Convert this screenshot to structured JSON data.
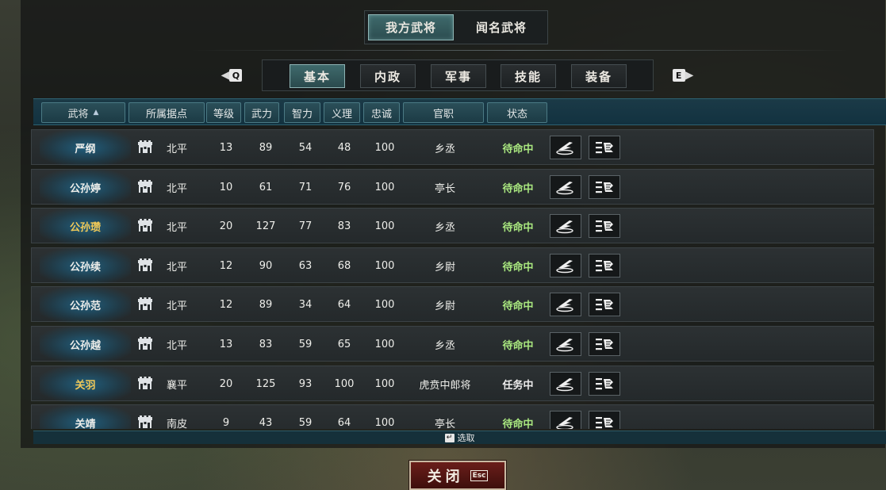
{
  "top_tabs": [
    {
      "label": "我方武将",
      "active": true
    },
    {
      "label": "闻名武将",
      "active": false
    }
  ],
  "nav": {
    "prev_key": "Q",
    "next_key": "E"
  },
  "sub_tabs": [
    {
      "label": "基本",
      "active": true
    },
    {
      "label": "内政",
      "active": false
    },
    {
      "label": "军事",
      "active": false
    },
    {
      "label": "技能",
      "active": false
    },
    {
      "label": "装备",
      "active": false
    }
  ],
  "columns": [
    "武将",
    "所属据点",
    "等级",
    "武力",
    "智力",
    "义理",
    "忠诚",
    "官职",
    "状态"
  ],
  "rows": [
    {
      "name": "严纲",
      "base": "北平",
      "level": "13",
      "str": "89",
      "int": "54",
      "honor": "48",
      "loyalty": "100",
      "title": "乡丞",
      "status": "待命中",
      "gold": false
    },
    {
      "name": "公孙婷",
      "base": "北平",
      "level": "10",
      "str": "61",
      "int": "71",
      "honor": "76",
      "loyalty": "100",
      "title": "亭长",
      "status": "待命中",
      "gold": false
    },
    {
      "name": "公孙瓒",
      "base": "北平",
      "level": "20",
      "str": "127",
      "int": "77",
      "honor": "83",
      "loyalty": "100",
      "title": "乡丞",
      "status": "待命中",
      "gold": true
    },
    {
      "name": "公孙续",
      "base": "北平",
      "level": "12",
      "str": "90",
      "int": "63",
      "honor": "68",
      "loyalty": "100",
      "title": "乡尉",
      "status": "待命中",
      "gold": false
    },
    {
      "name": "公孙范",
      "base": "北平",
      "level": "12",
      "str": "89",
      "int": "34",
      "honor": "64",
      "loyalty": "100",
      "title": "乡尉",
      "status": "待命中",
      "gold": false
    },
    {
      "name": "公孙越",
      "base": "北平",
      "level": "13",
      "str": "83",
      "int": "59",
      "honor": "65",
      "loyalty": "100",
      "title": "乡丞",
      "status": "待命中",
      "gold": false
    },
    {
      "name": "关羽",
      "base": "襄平",
      "level": "20",
      "str": "125",
      "int": "93",
      "honor": "100",
      "loyalty": "100",
      "title": "虎贲中郎将",
      "status": "任务中",
      "gold": true
    },
    {
      "name": "关靖",
      "base": "南皮",
      "level": "9",
      "str": "43",
      "int": "59",
      "honor": "64",
      "loyalty": "100",
      "title": "亭长",
      "status": "待命中",
      "gold": false
    }
  ],
  "footer": {
    "select_hint": "选取"
  },
  "close": {
    "label": "关闭",
    "key": "Esc"
  },
  "colors": {
    "status_idle": "#a9e77f",
    "status_busy": "#ececec",
    "name_gold": "#f0c958",
    "accent": "#3f6a6c"
  },
  "icons": {
    "base": "castle-icon",
    "action1": "command-icon",
    "action2": "menu-icon"
  }
}
